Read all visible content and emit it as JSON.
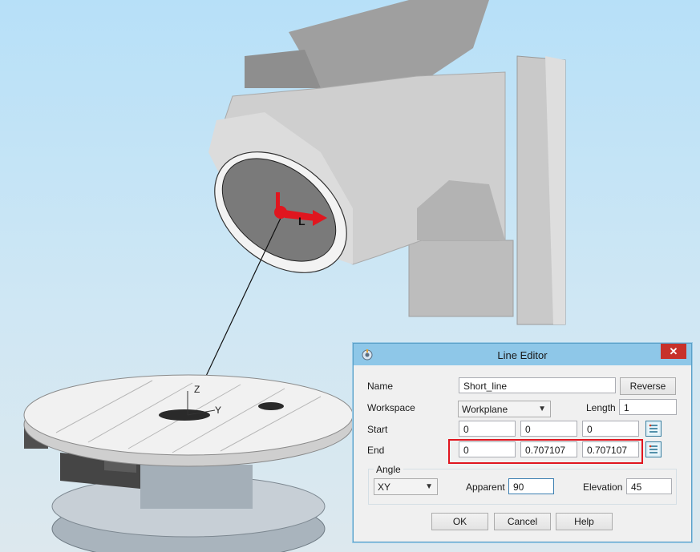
{
  "dialog": {
    "title": "Line Editor",
    "close_glyph": "✕",
    "name_label": "Name",
    "name_value": "Short_line",
    "reverse_label": "Reverse",
    "workspace_label": "Workspace",
    "workspace_value": "Workplane",
    "length_label": "Length",
    "length_value": "1",
    "start_label": "Start",
    "start": [
      "0",
      "0",
      "0"
    ],
    "end_label": "End",
    "end": [
      "0",
      "0.707107",
      "0.707107"
    ],
    "angle_group_label": "Angle",
    "angle_plane_value": "XY",
    "apparent_label": "Apparent",
    "apparent_value": "90",
    "elevation_label": "Elevation",
    "elevation_value": "45",
    "ok_label": "OK",
    "cancel_label": "Cancel",
    "help_label": "Help"
  },
  "scene": {
    "axis_labels": {
      "z": "Z",
      "y": "Y",
      "l": "L"
    },
    "highlight_color": "#e0161f",
    "title_bar_color": "#8ec7e8"
  }
}
